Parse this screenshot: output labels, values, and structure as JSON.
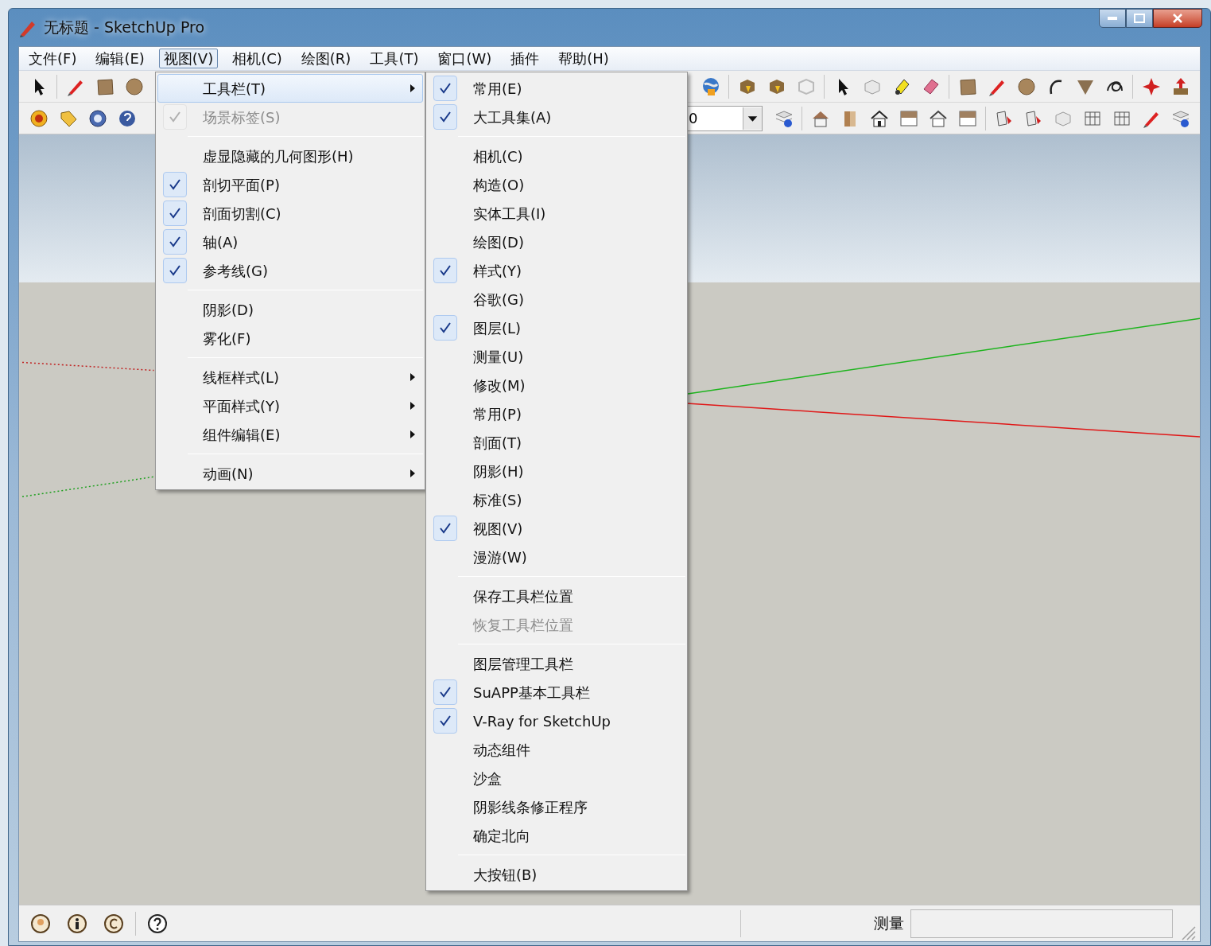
{
  "window": {
    "title": "无标题 - SketchUp Pro"
  },
  "menu_bar": [
    {
      "label": "文件(F)",
      "selected": false
    },
    {
      "label": "编辑(E)",
      "selected": false
    },
    {
      "label": "视图(V)",
      "selected": true
    },
    {
      "label": "相机(C)",
      "selected": false
    },
    {
      "label": "绘图(R)",
      "selected": false
    },
    {
      "label": "工具(T)",
      "selected": false
    },
    {
      "label": "窗口(W)",
      "selected": false
    },
    {
      "label": "插件",
      "selected": false
    },
    {
      "label": "帮助(H)",
      "selected": false
    }
  ],
  "toolbar": {
    "layer_field": {
      "value": "0"
    }
  },
  "view_menu": {
    "groups": [
      [
        {
          "label": "工具栏(T)",
          "checked": false,
          "disabled": false,
          "selected": true,
          "has_submenu": true
        },
        {
          "label": "场景标签(S)",
          "checked": true,
          "disabled": true,
          "selected": false,
          "has_submenu": false
        }
      ],
      [
        {
          "label": "虚显隐藏的几何图形(H)",
          "checked": false,
          "disabled": false,
          "selected": false,
          "has_submenu": false
        },
        {
          "label": "剖切平面(P)",
          "checked": true,
          "disabled": false,
          "selected": false,
          "has_submenu": false
        },
        {
          "label": "剖面切割(C)",
          "checked": true,
          "disabled": false,
          "selected": false,
          "has_submenu": false
        },
        {
          "label": "轴(A)",
          "checked": true,
          "disabled": false,
          "selected": false,
          "has_submenu": false
        },
        {
          "label": "参考线(G)",
          "checked": true,
          "disabled": false,
          "selected": false,
          "has_submenu": false
        }
      ],
      [
        {
          "label": "阴影(D)",
          "checked": false,
          "disabled": false,
          "selected": false,
          "has_submenu": false
        },
        {
          "label": "雾化(F)",
          "checked": false,
          "disabled": false,
          "selected": false,
          "has_submenu": false
        }
      ],
      [
        {
          "label": "线框样式(L)",
          "checked": false,
          "disabled": false,
          "selected": false,
          "has_submenu": true
        },
        {
          "label": "平面样式(Y)",
          "checked": false,
          "disabled": false,
          "selected": false,
          "has_submenu": true
        },
        {
          "label": "组件编辑(E)",
          "checked": false,
          "disabled": false,
          "selected": false,
          "has_submenu": true
        }
      ],
      [
        {
          "label": "动画(N)",
          "checked": false,
          "disabled": false,
          "selected": false,
          "has_submenu": true
        }
      ]
    ]
  },
  "toolbars_submenu": {
    "groups": [
      [
        {
          "label": "常用(E)",
          "checked": true,
          "disabled": false
        },
        {
          "label": "大工具集(A)",
          "checked": true,
          "disabled": false
        }
      ],
      [
        {
          "label": "相机(C)",
          "checked": false,
          "disabled": false
        },
        {
          "label": "构造(O)",
          "checked": false,
          "disabled": false
        },
        {
          "label": "实体工具(I)",
          "checked": false,
          "disabled": false
        },
        {
          "label": "绘图(D)",
          "checked": false,
          "disabled": false
        },
        {
          "label": "样式(Y)",
          "checked": true,
          "disabled": false
        },
        {
          "label": "谷歌(G)",
          "checked": false,
          "disabled": false
        },
        {
          "label": "图层(L)",
          "checked": true,
          "disabled": false
        },
        {
          "label": "测量(U)",
          "checked": false,
          "disabled": false
        },
        {
          "label": "修改(M)",
          "checked": false,
          "disabled": false
        },
        {
          "label": "常用(P)",
          "checked": false,
          "disabled": false
        },
        {
          "label": "剖面(T)",
          "checked": false,
          "disabled": false
        },
        {
          "label": "阴影(H)",
          "checked": false,
          "disabled": false
        },
        {
          "label": "标准(S)",
          "checked": false,
          "disabled": false
        },
        {
          "label": "视图(V)",
          "checked": true,
          "disabled": false
        },
        {
          "label": "漫游(W)",
          "checked": false,
          "disabled": false
        }
      ],
      [
        {
          "label": "保存工具栏位置",
          "checked": false,
          "disabled": false
        },
        {
          "label": "恢复工具栏位置",
          "checked": false,
          "disabled": true
        }
      ],
      [
        {
          "label": "图层管理工具栏",
          "checked": false,
          "disabled": false
        },
        {
          "label": "SuAPP基本工具栏",
          "checked": true,
          "disabled": false
        },
        {
          "label": "V-Ray for SketchUp",
          "checked": true,
          "disabled": false
        },
        {
          "label": "动态组件",
          "checked": false,
          "disabled": false
        },
        {
          "label": "沙盒",
          "checked": false,
          "disabled": false
        },
        {
          "label": "阴影线条修正程序",
          "checked": false,
          "disabled": false
        },
        {
          "label": "确定北向",
          "checked": false,
          "disabled": false
        }
      ],
      [
        {
          "label": "大按钮(B)",
          "checked": false,
          "disabled": false
        }
      ]
    ]
  },
  "status_bar": {
    "measure_label": "测量"
  }
}
